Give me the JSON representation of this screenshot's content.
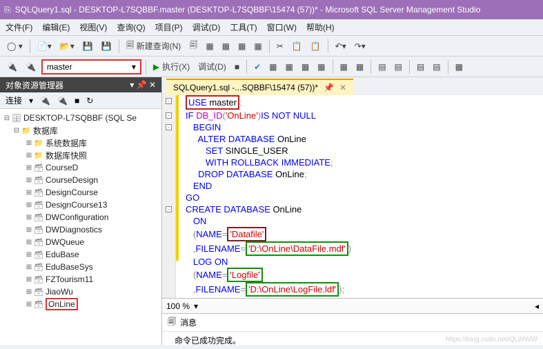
{
  "title": "SQLQuery1.sql - DESKTOP-L7SQBBF.master (DESKTOP-L7SQBBF\\15474 (57))* - Microsoft SQL Server Management Studio",
  "menu": {
    "file": "文件(F)",
    "edit": "编辑(E)",
    "view": "视图(V)",
    "query": "查询(Q)",
    "project": "项目(P)",
    "debug": "调试(D)",
    "tools": "工具(T)",
    "window": "窗口(W)",
    "help": "帮助(H)"
  },
  "toolbar": {
    "newquery": "新建查询(N)",
    "execute": "执行(X)",
    "debug": "调试(D)"
  },
  "db_selected": "master",
  "explorer": {
    "title": "对象资源管理器",
    "connect": "连接",
    "server": "DESKTOP-L7SQBBF (SQL Se",
    "dbfolder": "数据库",
    "sysdb": "系统数据库",
    "snapshot": "数据库快照",
    "items": [
      "CourseD",
      "CourseDesign",
      "DesignCourse",
      "DesignCourse13",
      "DWConfiguration",
      "DWDiagnostics",
      "DWQueue",
      "EduBase",
      "EduBaseSys",
      "FZTourism11",
      "JiaoWu",
      "OnLine"
    ]
  },
  "tab_label": "SQLQuery1.sql -...SQBBF\\15474 (57))*",
  "code": {
    "l1a": "USE",
    "l1b": " master",
    "l2a": "IF",
    "l2b": "DB_ID",
    "l2c": "'OnLine'",
    "l2d": "IS NOT NULL",
    "l3": "BEGIN",
    "l4": "ALTER DATABASE",
    "l4b": "OnLine",
    "l5": "SET",
    "l5b": "SINGLE_USER",
    "l6": "WITH ROLLBACK IMMEDIATE",
    "l7": "DROP DATABASE",
    "l7b": "OnLine",
    "l8": "END",
    "l9": "GO",
    "l10": "CREATE DATABASE",
    "l10b": "OnLine",
    "l11": "ON",
    "l12a": "NAME",
    "l12b": "'Datafile'",
    "l13a": "FILENAME",
    "l13b": "'D:\\OnLine\\DataFile.mdf'",
    "l14": "LOG ON",
    "l15a": "NAME",
    "l15b": "'Logfile'",
    "l16a": "FILENAME",
    "l16b": "'D:\\OnLine\\LogFile.ldf'"
  },
  "zoom": "100 %",
  "msg_tab": "消息",
  "msg_body": "命令已成功完成。",
  "watermark": "https://blog.csdn.net/QLWWW"
}
